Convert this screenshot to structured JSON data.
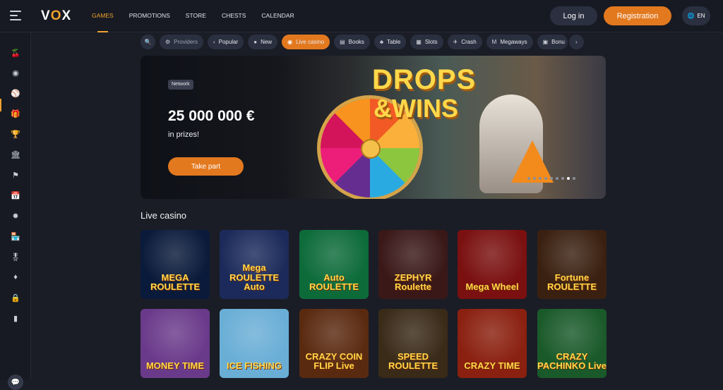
{
  "header": {
    "logo_text": "VOX",
    "nav": [
      "GAMES",
      "PROMOTIONS",
      "STORE",
      "CHESTS",
      "CALENDAR"
    ],
    "active_nav": "GAMES",
    "login_label": "Log in",
    "register_label": "Registration",
    "lang_label": "EN"
  },
  "filters": {
    "providers_label": "Providers",
    "categories": [
      "Popular",
      "New",
      "Live casino",
      "Books",
      "Table",
      "Slots",
      "Crash",
      "Megaways",
      "Bonu"
    ],
    "active": "Live casino"
  },
  "banner": {
    "badge": "Network",
    "amount": "25 000 000 €",
    "subtitle": "in prizes!",
    "cta_label": "Take part",
    "title_line1": "DROPS",
    "title_line2": "&WINS"
  },
  "section": {
    "title": "Live casino"
  },
  "games_row1": [
    {
      "name": "MEGA ROULETTE",
      "bg": "#0a1a3a"
    },
    {
      "name": "Mega ROULETTE Auto",
      "bg": "#1b2a5a"
    },
    {
      "name": "Auto ROULETTE",
      "bg": "#0d6b3a"
    },
    {
      "name": "ZEPHYR Roulette",
      "bg": "#3a1818"
    },
    {
      "name": "Mega Wheel",
      "bg": "#7a1010"
    },
    {
      "name": "Fortune ROULETTE",
      "bg": "#3a2010"
    }
  ],
  "games_row2": [
    {
      "name": "MONEY TIME",
      "bg": "#6a3a8a"
    },
    {
      "name": "ICE FISHING",
      "bg": "#6aaed6"
    },
    {
      "name": "CRAZY COIN FLIP Live",
      "bg": "#5a2a10"
    },
    {
      "name": "SPEED ROULETTE",
      "bg": "#3a2a18"
    },
    {
      "name": "CRAZY TIME",
      "bg": "#8a2010"
    },
    {
      "name": "CRAZY PACHINKO Live",
      "bg": "#1a5a2a"
    }
  ],
  "colors": {
    "accent": "#e3791f",
    "background": "#1a1d26",
    "panel": "#171a22",
    "chip": "#2b3040"
  }
}
